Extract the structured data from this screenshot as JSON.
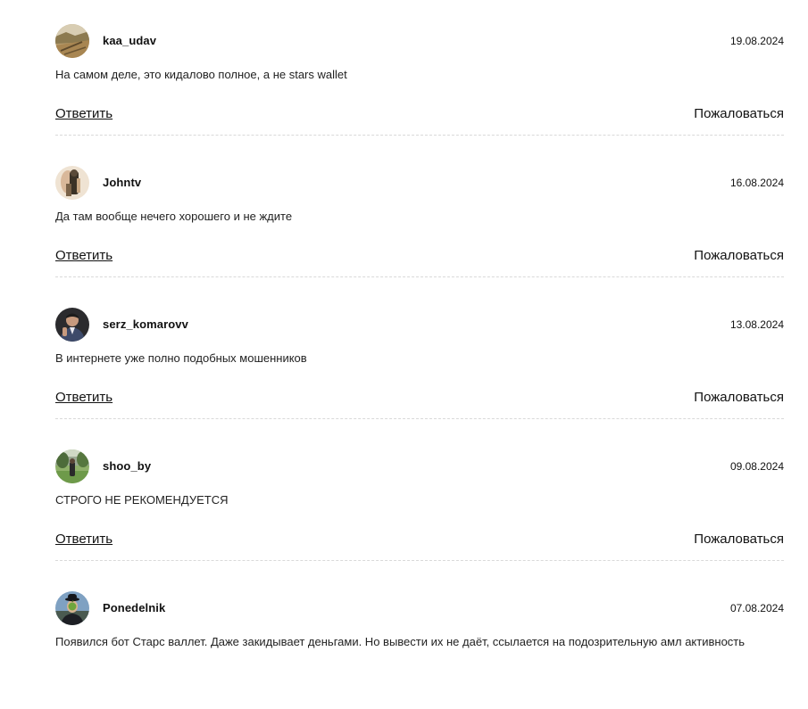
{
  "comments": [
    {
      "username": "kaa_udav",
      "date": "19.08.2024",
      "text": "На самом деле, это кидалово полное, а не stars wallet",
      "reply_label": "Ответить",
      "report_label": "Пожаловаться",
      "avatar_icon": "landscape-avatar-icon"
    },
    {
      "username": "Johntv",
      "date": "16.08.2024",
      "text": "Да там вообще нечего хорошего и не ждите",
      "reply_label": "Ответить",
      "report_label": "Пожаловаться",
      "avatar_icon": "figure-avatar-icon"
    },
    {
      "username": "serz_komarovv",
      "date": "13.08.2024",
      "text": "В интернете уже полно подобных мошенников",
      "reply_label": "Ответить",
      "report_label": "Пожаловаться",
      "avatar_icon": "man-portrait-avatar-icon"
    },
    {
      "username": "shoo_by",
      "date": "09.08.2024",
      "text": "СТРОГО НЕ РЕКОМЕНДУЕТСЯ",
      "reply_label": "Ответить",
      "report_label": "Пожаловаться",
      "avatar_icon": "park-avatar-icon"
    },
    {
      "username": "Ponedelnik",
      "date": "07.08.2024",
      "text": "Появился бот Старс валлет. Даже закидывает деньгами. Но вывести их не даёт, ссылается на подозрительную амл активность",
      "reply_label": "",
      "report_label": "",
      "avatar_icon": "bowler-hat-man-avatar-icon"
    }
  ]
}
